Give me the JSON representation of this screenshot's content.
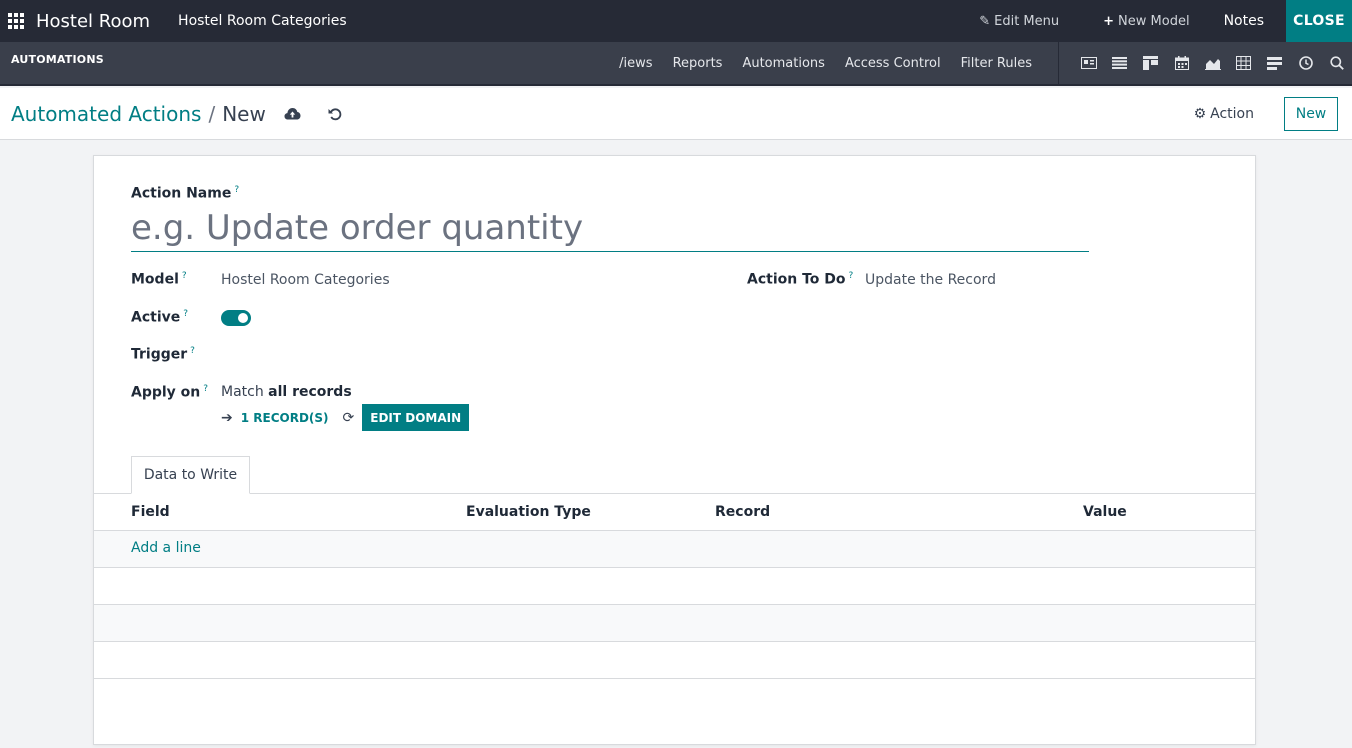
{
  "topbar": {
    "app_title": "Hostel Room",
    "model_title": "Hostel Room Categories",
    "edit_menu": "Edit Menu",
    "new_model": "New Model",
    "notes": "Notes",
    "close": "CLOSE"
  },
  "subbar": {
    "title": "AUTOMATIONS",
    "menu": [
      "/iews",
      "Reports",
      "Automations",
      "Access Control",
      "Filter Rules"
    ],
    "view_icons": [
      "form-view-icon",
      "list-view-icon",
      "kanban-view-icon",
      "calendar-view-icon",
      "graph-view-icon",
      "pivot-view-icon",
      "activity-view-icon",
      "clock-view-icon",
      "search-icon"
    ]
  },
  "control": {
    "breadcrumb_parent": "Automated Actions",
    "breadcrumb_sep": "/",
    "breadcrumb_current": "New",
    "action": "Action",
    "new": "New"
  },
  "form": {
    "action_name_label": "Action Name",
    "action_name_placeholder": "e.g. Update order quantity",
    "model_label": "Model",
    "model_value": "Hostel Room Categories",
    "action_to_do_label": "Action To Do",
    "action_to_do_value": "Update the Record",
    "active_label": "Active",
    "trigger_label": "Trigger",
    "apply_on_label": "Apply on",
    "apply_on_prefix": "Match",
    "apply_on_bold": "all records",
    "records_link": "1 RECORD(S)",
    "edit_domain": "EDIT DOMAIN",
    "help": "?"
  },
  "tabs": {
    "data_to_write": "Data to Write"
  },
  "table": {
    "columns": [
      "Field",
      "Evaluation Type",
      "Record",
      "Value"
    ],
    "add_line": "Add a line"
  },
  "colors": {
    "accent": "#017e84",
    "topbar": "#262a36",
    "subbar": "#3a3f4b"
  }
}
